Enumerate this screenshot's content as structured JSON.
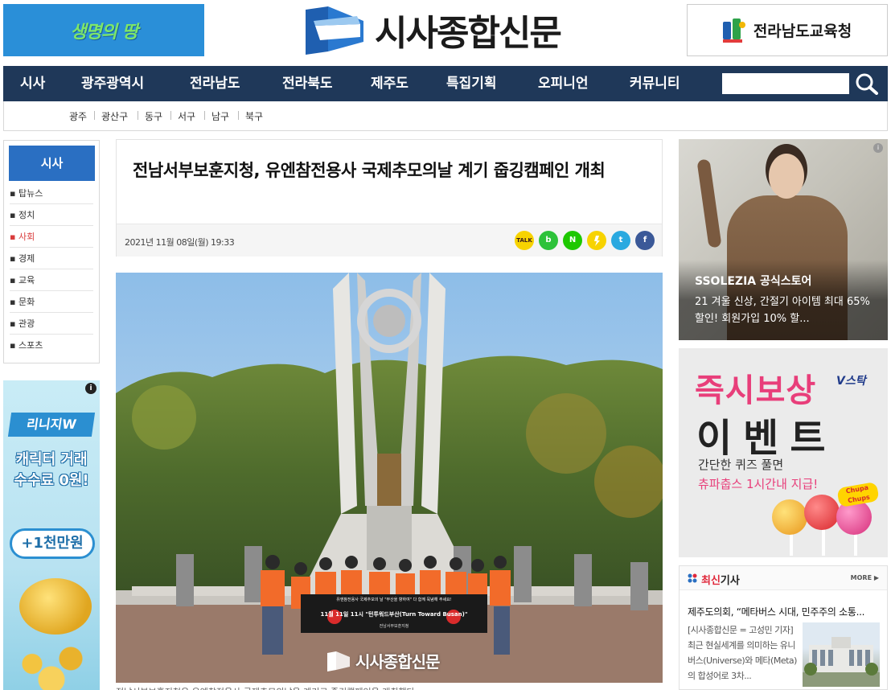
{
  "header": {
    "left_banner_text": "생명의 땅",
    "logo_text": "시사종합신문",
    "right_banner_text": "전라남도교육청"
  },
  "nav": {
    "items": [
      "시사",
      "광주광역시",
      "전라남도",
      "전라북도",
      "제주도",
      "특집기획",
      "오피니언",
      "커뮤니티"
    ],
    "search_placeholder": ""
  },
  "subnav": {
    "items": [
      "광주",
      "광산구",
      "동구",
      "서구",
      "남구",
      "북구"
    ]
  },
  "sidebar": {
    "title": "시사",
    "items": [
      "탑뉴스",
      "정치",
      "사회",
      "경제",
      "교육",
      "문화",
      "관광",
      "스포츠"
    ],
    "active_index": 2
  },
  "left_ad": {
    "brand": "리니지W",
    "line1": "캐릭터 거래",
    "line2": "수수료 0원!",
    "pill": "+1천만원",
    "info": "i"
  },
  "article": {
    "title": "전남서부보훈지청, 유엔참전용사 국제추모의날 계기 줍깅캠페인 개최",
    "date": "2021년 11월 08일(월) 19:33",
    "share": [
      "TALK",
      "b",
      "N",
      "",
      "t",
      "f"
    ],
    "banner_line1": "유엔참전용사 국제추모의 날 \"부산을 향하여\" 다 함께 묵념해 주세요!",
    "banner_line2": "11월 11일 11시 \"턴투워드부산(Turn Toward Busan)\"",
    "banner_line3": "전남서부보훈지청",
    "watermark": "시사종합신문",
    "caption": "전남서부보훈지청은 유엔참전용사 국제추모의날을 계기로 줍깅캠페인을 개최했다."
  },
  "right_ad1": {
    "title": "SSOLEZIA 공식스토어",
    "text": "21 겨울 신상, 간절기 아이템 최대 65% 할인! 회원가입 10% 할...",
    "info": "i"
  },
  "right_ad2": {
    "line1": "즉시보상",
    "brand": "V스탁",
    "line2": "이벤트",
    "line3": "간단한 퀴즈 풀면",
    "line4": "츄파춥스 1시간내 지급!",
    "candy": "Chupa Chups"
  },
  "latest": {
    "title_red": "최신",
    "title_rest": "기사",
    "more": "MORE ▶",
    "headline": "제주도의회, “메타버스 시대, 민주주의 소통...",
    "body": "[시사종합신문 = 고성민 기자] 최근 현실세계를 의미하는 유니버스(Universe)와 메타(Meta)의 합성어로 3차..."
  },
  "colors": {
    "nav_bg": "#1f3859",
    "sidebar_title_bg": "#2a6fc2",
    "active": "#d93c3c",
    "accent_pink": "#e83e7a"
  }
}
